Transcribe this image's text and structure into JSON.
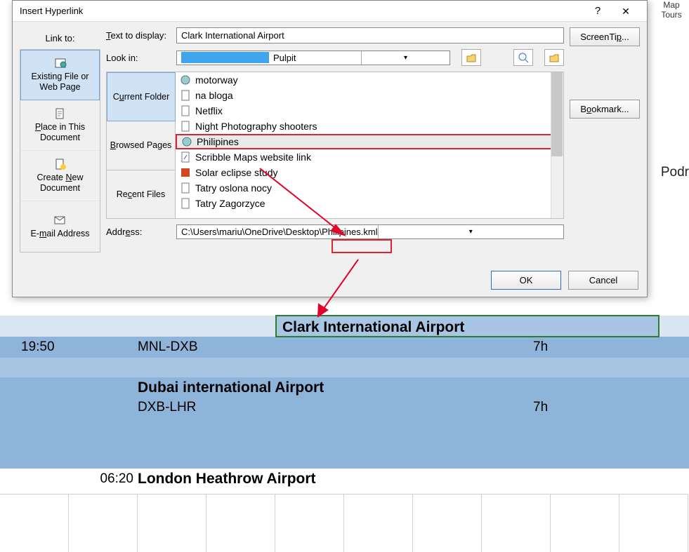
{
  "ribbon": {
    "map": "Map",
    "tours": "Tours"
  },
  "sheet": {
    "right_cut": "Podr",
    "rows": [
      {
        "name": "Clark International Airport"
      },
      {
        "time": "19:50",
        "name": "MNL-DXB",
        "dur": "7h"
      },
      {
        "name": "Dubai international Airport"
      },
      {
        "name": "DXB-LHR",
        "dur": "7h"
      },
      {
        "time": "06:20",
        "name": "London Heathrow Airport"
      }
    ]
  },
  "dialog": {
    "title": "Insert Hyperlink",
    "linkto_label": "Link to:",
    "linkto": [
      "Existing File or Web Page",
      "Place in This Document",
      "Create New Document",
      "E-mail Address"
    ],
    "text_to_display_label": "Text to display:",
    "text_to_display": "Clark International Airport",
    "lookin_label": "Look in:",
    "lookin_value": "Pulpit",
    "tabs": [
      "Current Folder",
      "Browsed Pages",
      "Recent Files"
    ],
    "files": [
      "motorway",
      "na bloga",
      "Netflix",
      "Night Photography shooters",
      "Philipines",
      "Scribble Maps website link",
      "Solar eclipse study",
      "Tatry oslona nocy",
      "Tatry Zagorzyce"
    ],
    "address_label": "Address:",
    "address": "C:\\Users\\mariu\\OneDrive\\Desktop\\Philipines.kml",
    "screentip": "ScreenTip...",
    "bookmark": "Bookmark...",
    "ok": "OK",
    "cancel": "Cancel"
  }
}
